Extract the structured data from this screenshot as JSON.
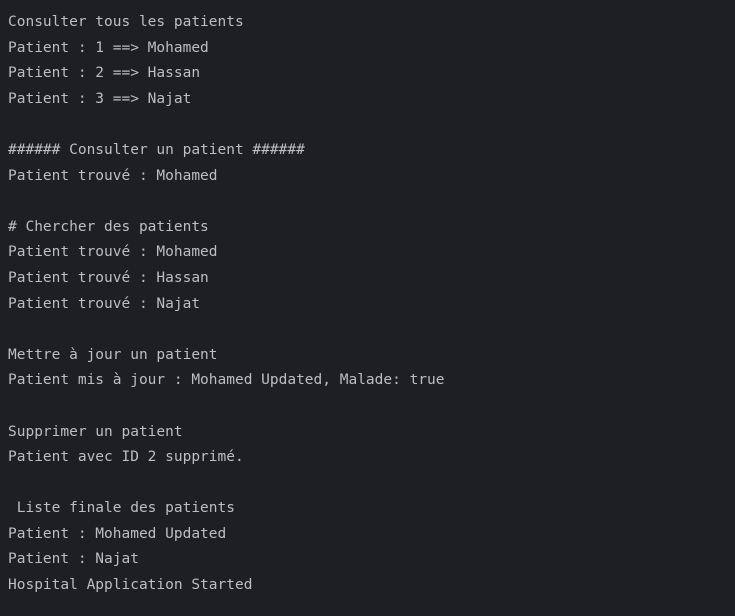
{
  "console": {
    "lines": [
      "Consulter tous les patients",
      "Patient : 1 ==> Mohamed",
      "Patient : 2 ==> Hassan",
      "Patient : 3 ==> Najat",
      "",
      "###### Consulter un patient ######",
      "Patient trouvé : Mohamed",
      "",
      "# Chercher des patients",
      "Patient trouvé : Mohamed",
      "Patient trouvé : Hassan",
      "Patient trouvé : Najat",
      "",
      "Mettre à jour un patient",
      "Patient mis à jour : Mohamed Updated, Malade: true",
      "",
      "Supprimer un patient",
      "Patient avec ID 2 supprimé.",
      "",
      " Liste finale des patients",
      "Patient : Mohamed Updated",
      "Patient : Najat",
      "Hospital Application Started"
    ]
  }
}
